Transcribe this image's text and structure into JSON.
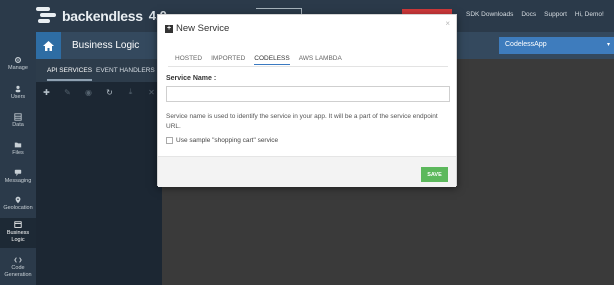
{
  "app": {
    "logo_text": "backendless",
    "version": "4.0"
  },
  "top_links": [
    "SDK Downloads",
    "Docs",
    "Support",
    "Hi, Demo!"
  ],
  "sidebar": {
    "items": [
      {
        "label": "Manage",
        "icon": "gear-icon"
      },
      {
        "label": "Users",
        "icon": "users-icon"
      },
      {
        "label": "Data",
        "icon": "database-icon"
      },
      {
        "label": "Files",
        "icon": "folder-icon"
      },
      {
        "label": "Messaging",
        "icon": "chat-icon"
      },
      {
        "label": "Geolocation",
        "icon": "map-pin-icon"
      },
      {
        "label": "Business Logic",
        "icon": "code-window-icon",
        "active": true
      },
      {
        "label": "Code Generation",
        "icon": "code-brackets-icon"
      }
    ]
  },
  "header": {
    "title": "Business Logic",
    "app_selector": "CodelessApp"
  },
  "panel": {
    "tabs": [
      "API SERVICES",
      "EVENT HANDLERS"
    ]
  },
  "modal": {
    "title": "New Service",
    "close": "×",
    "tabs": [
      "HOSTED",
      "IMPORTED",
      "CODELESS",
      "AWS LAMBDA"
    ],
    "active_tab": "CODELESS",
    "service_name_label": "Service Name :",
    "service_name_value": "",
    "help_text": "Service name is used to identify the service in your app. It will be a part of the service endpoint URL.",
    "checkbox_label": "Use sample \"shopping cart\" service",
    "checkbox_checked": false,
    "save_label": "SAVE"
  },
  "colors": {
    "accent": "#3b7ac1",
    "save": "#5cb85c",
    "nav_bg": "#2b3a4a"
  }
}
